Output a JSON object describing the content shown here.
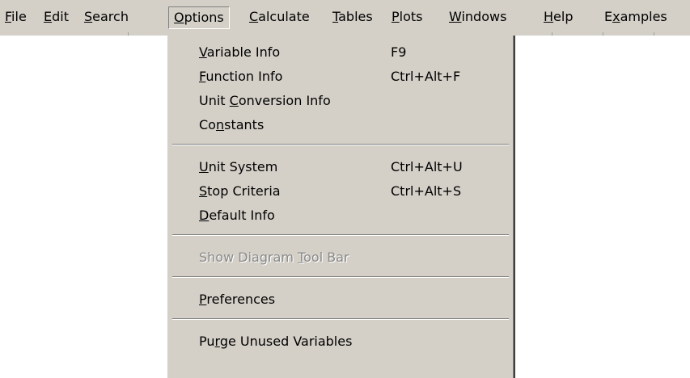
{
  "menubar": {
    "items": [
      {
        "label": "File",
        "mnemonic": "F",
        "active": false
      },
      {
        "label": "Edit",
        "mnemonic": "E",
        "active": false
      },
      {
        "label": "Search",
        "mnemonic": "S",
        "active": false
      },
      {
        "label": "Options",
        "mnemonic": "O",
        "active": true
      },
      {
        "label": "Calculate",
        "mnemonic": "C",
        "active": false
      },
      {
        "label": "Tables",
        "mnemonic": "T",
        "active": false
      },
      {
        "label": "Plots",
        "mnemonic": "P",
        "active": false
      },
      {
        "label": "Windows",
        "mnemonic": "W",
        "active": false
      },
      {
        "label": "Help",
        "mnemonic": "H",
        "active": false
      },
      {
        "label": "Examples",
        "mnemonic": "x",
        "active": false
      }
    ]
  },
  "options_menu": {
    "items": [
      {
        "label": "Variable Info",
        "mnemonic": "V",
        "accel": "F9",
        "enabled": true
      },
      {
        "label": "Function Info",
        "mnemonic": "F",
        "accel": "Ctrl+Alt+F",
        "enabled": true
      },
      {
        "label": "Unit Conversion Info",
        "mnemonic": "C",
        "accel": "",
        "enabled": true
      },
      {
        "label": "Constants",
        "mnemonic": "n",
        "accel": "",
        "enabled": true
      },
      {
        "separator": true
      },
      {
        "label": "Unit System",
        "mnemonic": "U",
        "accel": "Ctrl+Alt+U",
        "enabled": true
      },
      {
        "label": "Stop Criteria",
        "mnemonic": "S",
        "accel": "Ctrl+Alt+S",
        "enabled": true
      },
      {
        "label": "Default Info",
        "mnemonic": "D",
        "accel": "",
        "enabled": true
      },
      {
        "separator": true
      },
      {
        "label": "Show Diagram Tool Bar",
        "mnemonic": "T",
        "accel": "",
        "enabled": false
      },
      {
        "separator": true
      },
      {
        "label": "Preferences",
        "mnemonic": "P",
        "accel": "",
        "enabled": true
      },
      {
        "separator": true
      },
      {
        "label": "Purge Unused Variables",
        "mnemonic": "r",
        "accel": "",
        "enabled": true
      }
    ]
  }
}
